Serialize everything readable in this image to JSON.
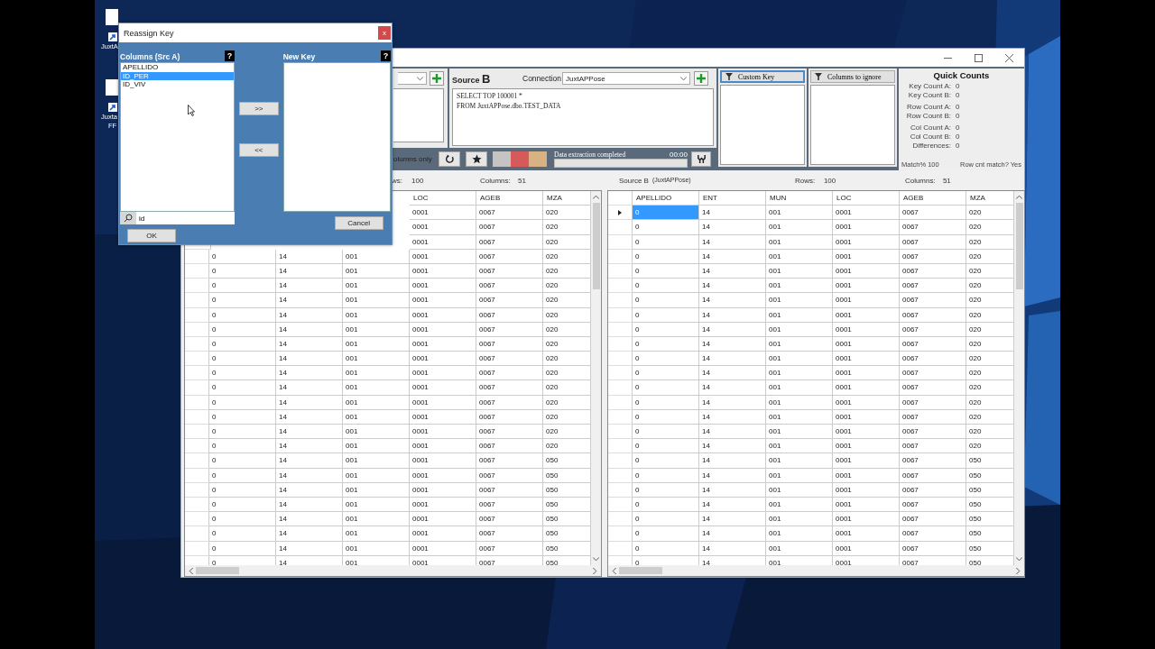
{
  "desktop": {
    "icons": [
      {
        "lines": [
          "JuxtA"
        ]
      },
      {
        "lines": [
          "Juxta",
          "FF"
        ]
      }
    ]
  },
  "main_window": {
    "source_b": {
      "title": "Source",
      "letter": "B",
      "connection_label": "Connection",
      "connection": "JuxtAPPose",
      "query": [
        "SELECT TOP 100001 *",
        "FROM JuxtAPPose.dbo.TEST_DATA"
      ]
    },
    "toolbar": {
      "option_label": "olumns only",
      "swatches": [
        {
          "color": "#c4c4c4"
        },
        {
          "color": "#d65a5a"
        },
        {
          "color": "#d9b283"
        }
      ],
      "status": "Data extraction completed",
      "time": "00:00",
      "level": 0
    },
    "filters": [
      {
        "label": "Custom Key",
        "selected": true
      },
      {
        "label": "Columns to ignore",
        "selected": false
      }
    ],
    "quick_counts": {
      "title": "Quick Counts",
      "groups": [
        [
          {
            "label": "Key Count A:",
            "value": "0"
          },
          {
            "label": "Key Count B:",
            "value": "0"
          }
        ],
        [
          {
            "label": "Row Count A:",
            "value": "0"
          },
          {
            "label": "Row Count B:",
            "value": "0"
          }
        ],
        [
          {
            "label": "Col Count A:",
            "value": "0"
          },
          {
            "label": "Col Count B:",
            "value": "0"
          },
          {
            "label": "Differences:",
            "value": "0"
          }
        ]
      ],
      "match": "Match% 100",
      "row_match": "Row cnt match? Yes"
    },
    "grid_a": {
      "rows_label": "ws:",
      "rows_count": "100",
      "columns_label": "Columns:",
      "columns_count": "51",
      "headers": [
        "LOC",
        "AGEB",
        "MZA"
      ],
      "rows": [
        [
          "0001",
          "0067",
          "020"
        ],
        [
          "0001",
          "0067",
          "020"
        ],
        [
          "0001",
          "0067",
          "020"
        ],
        [
          "0",
          "14",
          "001",
          "0001",
          "0067",
          "020"
        ],
        [
          "0",
          "14",
          "001",
          "0001",
          "0067",
          "020"
        ],
        [
          "0",
          "14",
          "001",
          "0001",
          "0067",
          "020"
        ],
        [
          "0",
          "14",
          "001",
          "0001",
          "0067",
          "020"
        ],
        [
          "0",
          "14",
          "001",
          "0001",
          "0067",
          "020"
        ],
        [
          "0",
          "14",
          "001",
          "0001",
          "0067",
          "020"
        ],
        [
          "0",
          "14",
          "001",
          "0001",
          "0067",
          "020"
        ],
        [
          "0",
          "14",
          "001",
          "0001",
          "0067",
          "020"
        ],
        [
          "0",
          "14",
          "001",
          "0001",
          "0067",
          "020"
        ],
        [
          "0",
          "14",
          "001",
          "0001",
          "0067",
          "020"
        ],
        [
          "0",
          "14",
          "001",
          "0001",
          "0067",
          "020"
        ],
        [
          "0",
          "14",
          "001",
          "0001",
          "0067",
          "020"
        ],
        [
          "0",
          "14",
          "001",
          "0001",
          "0067",
          "020"
        ],
        [
          "0",
          "14",
          "001",
          "0001",
          "0067",
          "020"
        ],
        [
          "0",
          "14",
          "001",
          "0001",
          "0067",
          "050"
        ],
        [
          "0",
          "14",
          "001",
          "0001",
          "0067",
          "050"
        ],
        [
          "0",
          "14",
          "001",
          "0001",
          "0067",
          "050"
        ],
        [
          "0",
          "14",
          "001",
          "0001",
          "0067",
          "050"
        ],
        [
          "0",
          "14",
          "001",
          "0001",
          "0067",
          "050"
        ],
        [
          "0",
          "14",
          "001",
          "0001",
          "0067",
          "050"
        ],
        [
          "0",
          "14",
          "001",
          "0001",
          "0067",
          "050"
        ],
        [
          "0",
          "14",
          "001",
          "0001",
          "0067",
          "050"
        ]
      ]
    },
    "grid_b": {
      "title": "Source B",
      "source": "(JuxtAPPose)",
      "rows_label": "Rows:",
      "rows_count": "100",
      "columns_label": "Columns:",
      "columns_count": "51",
      "headers": [
        "APELLIDO",
        "ENT",
        "MUN",
        "LOC",
        "AGEB",
        "MZA"
      ],
      "rows": [
        {
          "cells": [
            "0",
            "14",
            "001",
            "0001",
            "0067",
            "020"
          ],
          "selected": true
        },
        {
          "cells": [
            "0",
            "14",
            "001",
            "0001",
            "0067",
            "020"
          ],
          "selected": false
        },
        {
          "cells": [
            "0",
            "14",
            "001",
            "0001",
            "0067",
            "020"
          ],
          "selected": false
        },
        {
          "cells": [
            "0",
            "14",
            "001",
            "0001",
            "0067",
            "020"
          ],
          "selected": false
        },
        {
          "cells": [
            "0",
            "14",
            "001",
            "0001",
            "0067",
            "020"
          ],
          "selected": false
        },
        {
          "cells": [
            "0",
            "14",
            "001",
            "0001",
            "0067",
            "020"
          ],
          "selected": false
        },
        {
          "cells": [
            "0",
            "14",
            "001",
            "0001",
            "0067",
            "020"
          ],
          "selected": false
        },
        {
          "cells": [
            "0",
            "14",
            "001",
            "0001",
            "0067",
            "020"
          ],
          "selected": false
        },
        {
          "cells": [
            "0",
            "14",
            "001",
            "0001",
            "0067",
            "020"
          ],
          "selected": false
        },
        {
          "cells": [
            "0",
            "14",
            "001",
            "0001",
            "0067",
            "020"
          ],
          "selected": false
        },
        {
          "cells": [
            "0",
            "14",
            "001",
            "0001",
            "0067",
            "020"
          ],
          "selected": false
        },
        {
          "cells": [
            "0",
            "14",
            "001",
            "0001",
            "0067",
            "020"
          ],
          "selected": false
        },
        {
          "cells": [
            "0",
            "14",
            "001",
            "0001",
            "0067",
            "020"
          ],
          "selected": false
        },
        {
          "cells": [
            "0",
            "14",
            "001",
            "0001",
            "0067",
            "020"
          ],
          "selected": false
        },
        {
          "cells": [
            "0",
            "14",
            "001",
            "0001",
            "0067",
            "020"
          ],
          "selected": false
        },
        {
          "cells": [
            "0",
            "14",
            "001",
            "0001",
            "0067",
            "020"
          ],
          "selected": false
        },
        {
          "cells": [
            "0",
            "14",
            "001",
            "0001",
            "0067",
            "020"
          ],
          "selected": false
        },
        {
          "cells": [
            "0",
            "14",
            "001",
            "0001",
            "0067",
            "050"
          ],
          "selected": false
        },
        {
          "cells": [
            "0",
            "14",
            "001",
            "0001",
            "0067",
            "050"
          ],
          "selected": false
        },
        {
          "cells": [
            "0",
            "14",
            "001",
            "0001",
            "0067",
            "050"
          ],
          "selected": false
        },
        {
          "cells": [
            "0",
            "14",
            "001",
            "0001",
            "0067",
            "050"
          ],
          "selected": false
        },
        {
          "cells": [
            "0",
            "14",
            "001",
            "0001",
            "0067",
            "050"
          ],
          "selected": false
        },
        {
          "cells": [
            "0",
            "14",
            "001",
            "0001",
            "0067",
            "050"
          ],
          "selected": false
        },
        {
          "cells": [
            "0",
            "14",
            "001",
            "0001",
            "0067",
            "050"
          ],
          "selected": false
        },
        {
          "cells": [
            "0",
            "14",
            "001",
            "0001",
            "0067",
            "050"
          ],
          "selected": false
        }
      ]
    }
  },
  "dialog": {
    "title": "Reassign Key",
    "close": "x",
    "left_title": "Columns (Src A)",
    "left_help": "?",
    "items": [
      {
        "label": "APELLIDO",
        "selected": false
      },
      {
        "label": "ID_PER",
        "selected": true
      },
      {
        "label": "ID_VIV",
        "selected": false
      }
    ],
    "filter": "id",
    "add_button": ">>",
    "remove_button": "<<",
    "right_title": "New Key",
    "right_help": "?",
    "ok": "OK",
    "cancel": "Cancel"
  }
}
